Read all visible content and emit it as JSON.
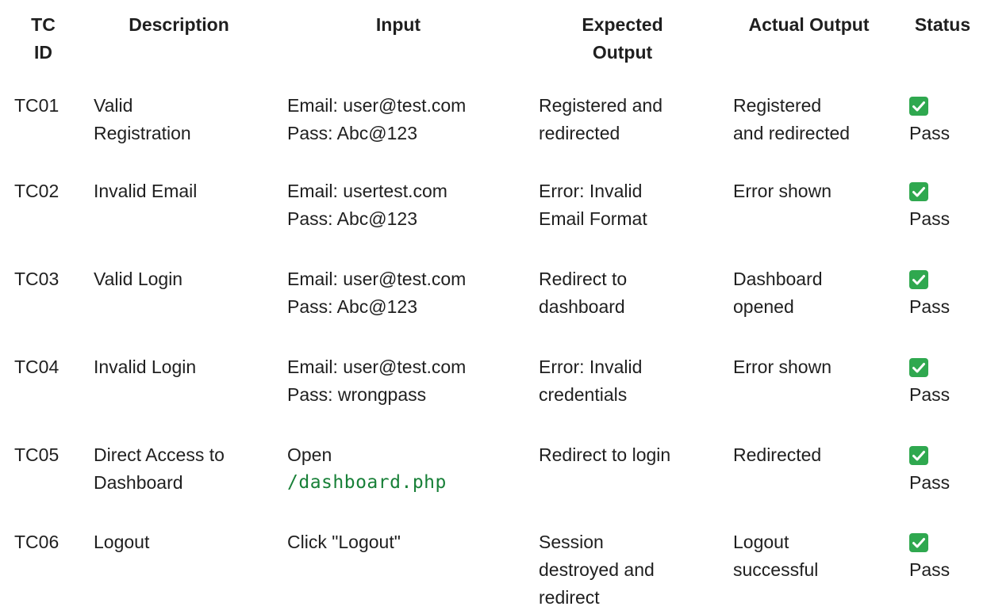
{
  "header": {
    "tc_id": [
      "TC",
      "ID"
    ],
    "description": "Description",
    "input": "Input",
    "expected_output": [
      "Expected",
      "Output"
    ],
    "actual_output": "Actual Output",
    "status": "Status"
  },
  "rows": [
    {
      "id": "TC01",
      "description": [
        "Valid",
        "Registration"
      ],
      "input": [
        "Email: user@test.com",
        "Pass: Abc@123"
      ],
      "expected": [
        "Registered and",
        "redirected"
      ],
      "actual": [
        "Registered",
        "and redirected"
      ],
      "status": "Pass"
    },
    {
      "id": "TC02",
      "description": [
        "Invalid Email"
      ],
      "input": [
        "Email: usertest.com",
        "Pass: Abc@123"
      ],
      "expected": [
        "Error: Invalid",
        "Email Format"
      ],
      "actual": [
        "Error shown"
      ],
      "status": "Pass"
    },
    {
      "id": "TC03",
      "description": [
        "Valid Login"
      ],
      "input": [
        "Email: user@test.com",
        "Pass: Abc@123"
      ],
      "expected": [
        "Redirect to",
        "dashboard"
      ],
      "actual": [
        "Dashboard",
        "opened"
      ],
      "status": "Pass"
    },
    {
      "id": "TC04",
      "description": [
        "Invalid Login"
      ],
      "input": [
        "Email: user@test.com",
        "Pass: wrongpass"
      ],
      "expected": [
        "Error: Invalid",
        "credentials"
      ],
      "actual": [
        "Error shown"
      ],
      "status": "Pass"
    },
    {
      "id": "TC05",
      "description": [
        "Direct Access to",
        "Dashboard"
      ],
      "input_text": "Open",
      "input_code": "/dashboard.php",
      "expected": [
        "Redirect to login"
      ],
      "actual": [
        "Redirected"
      ],
      "status": "Pass"
    },
    {
      "id": "TC06",
      "description": [
        "Logout"
      ],
      "input": [
        "Click \"Logout\""
      ],
      "expected": [
        "Session",
        "destroyed and",
        "redirect"
      ],
      "actual": [
        "Logout",
        "successful"
      ],
      "status": "Pass"
    }
  ],
  "status_icon": "check-mark-icon",
  "colors": {
    "text": "#1f1f1f",
    "code": "#188038",
    "check_bg": "#2fa84f"
  }
}
